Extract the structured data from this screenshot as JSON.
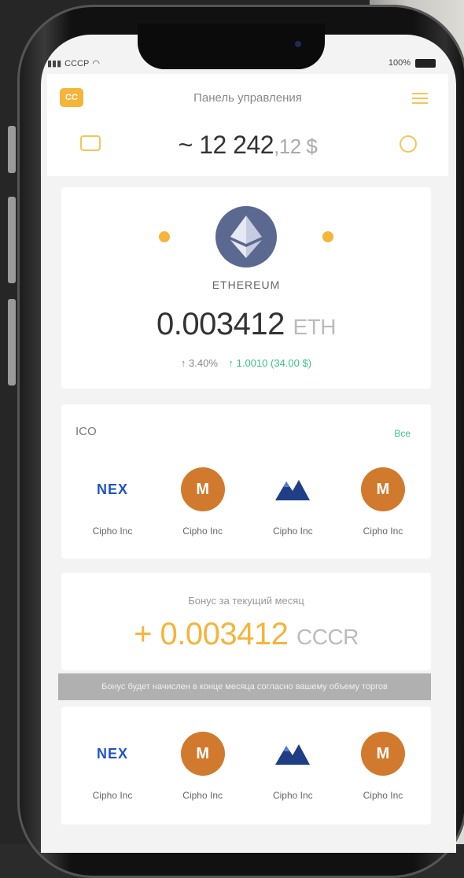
{
  "status_bar": {
    "carrier": "CCCP",
    "time": "",
    "battery": "100%"
  },
  "header": {
    "badge": "CC",
    "title": "Панель управления",
    "balance_main": "~ 12 242",
    "balance_decimal": ",12 $"
  },
  "coin": {
    "name": "ETHEREUM",
    "amount": "0.003412",
    "unit": "ETH",
    "change_pct": "↑ 3.40%",
    "change_value": "↑ 1.0010 (34.00 $)"
  },
  "ico": {
    "section_label": "ICO",
    "all_link": "Все",
    "items": [
      {
        "logo": "NEX",
        "label": "Cipho Inc",
        "icon": "nex-logo"
      },
      {
        "logo": "M",
        "label": "Cipho Inc",
        "icon": "moon-logo"
      },
      {
        "logo": "",
        "label": "Cipho Inc",
        "icon": "mountain-logo"
      },
      {
        "logo": "M",
        "label": "Cipho Inc",
        "icon": "moon-logo"
      }
    ]
  },
  "bonus": {
    "label": "Бонус за текущий месяц",
    "amount": "+ 0.003412",
    "unit": "CCCR"
  },
  "notice": "Бонус будет начислен в конце месяца согласно вашему объему торгов",
  "tiles2": {
    "items": [
      {
        "logo": "NEX",
        "label": "Cipho Inc",
        "icon": "nex-logo"
      },
      {
        "logo": "M",
        "label": "Cipho Inc",
        "icon": "moon-logo"
      },
      {
        "logo": "",
        "label": "Cipho Inc",
        "icon": "mountain-logo"
      },
      {
        "logo": "M",
        "label": "Cipho Inc",
        "icon": "moon-logo"
      }
    ]
  },
  "colors": {
    "accent": "#f5b43a",
    "positive": "#3cc08a",
    "eth": "#5b6890",
    "nex": "#2152c7",
    "moon": "#d17a2e"
  }
}
